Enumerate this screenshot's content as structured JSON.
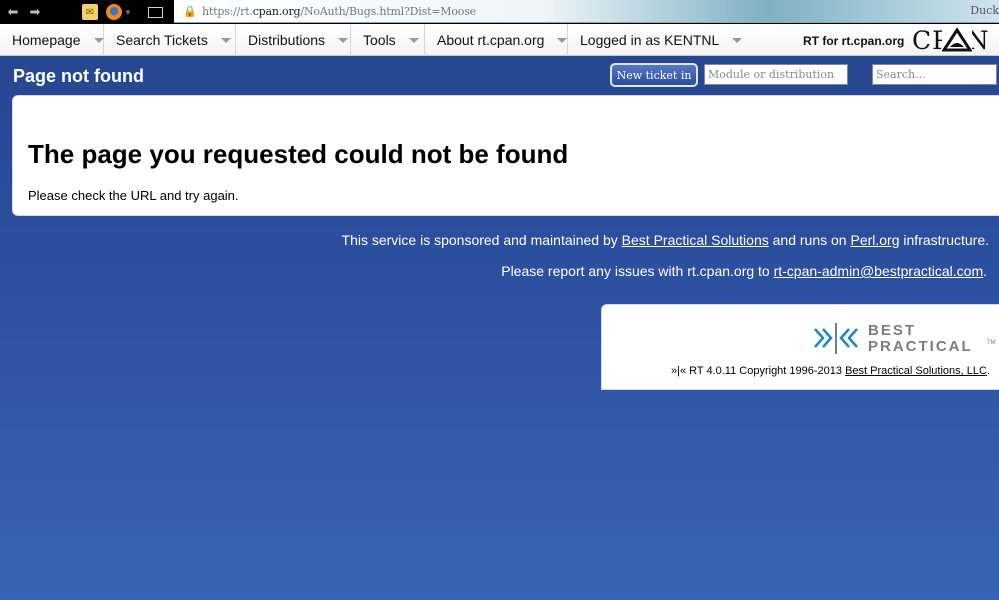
{
  "browser": {
    "url_prefix": "https://rt.",
    "url_domain": "cpan.org",
    "url_path": "/NoAuth/Bugs.html?Dist=Moose",
    "search_engine_label": "Duck",
    "icons": {
      "back": "back-arrow-icon",
      "forward": "forward-arrow-icon",
      "mail": "mail-icon",
      "firefox": "firefox-icon",
      "window": "window-icon",
      "lock": "lock-icon"
    }
  },
  "menu": {
    "items": [
      {
        "label": "Homepage"
      },
      {
        "label": "Search Tickets"
      },
      {
        "label": "Distributions"
      },
      {
        "label": "Tools"
      },
      {
        "label": "About rt.cpan.org"
      },
      {
        "label": "Logged in as KENTNL"
      }
    ],
    "site_label": "RT for rt.cpan.org",
    "logo_text": "CPAN"
  },
  "header": {
    "title": "Page not found",
    "new_ticket_label": "New ticket in",
    "module_placeholder": "Module or distribution",
    "search_placeholder": "Search..."
  },
  "content": {
    "heading": "The page you requested could not be found",
    "message": "Please check the URL and try again."
  },
  "footer": {
    "line1_before": "This service is sponsored and maintained by ",
    "line1_link": "Best Practical Solutions",
    "line1_middle": " and runs on ",
    "line1_link2": "Perl.org",
    "line1_after": " infrastructure.",
    "line2_before": "Please report any issues with rt.cpan.org to ",
    "line2_link": "rt-cpan-admin@bestpractical.com",
    "line2_after": "."
  },
  "best_practical": {
    "word1": "BEST",
    "word2": "PRACTICAL",
    "tm": "TM",
    "copyright_before": "»|« RT 4.0.11 Copyright 1996-2013 ",
    "copyright_link": "Best Practical Solutions, LLC",
    "copyright_after": "."
  },
  "colors": {
    "page_bg": "#2c4fa0",
    "bp_blue": "#1f86c8",
    "bp_gray": "#7d7d7d"
  }
}
